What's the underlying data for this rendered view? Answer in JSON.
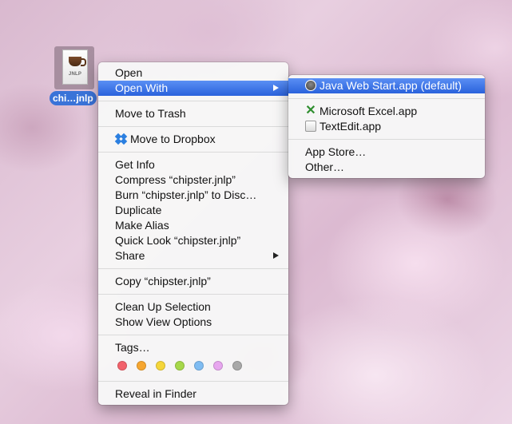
{
  "desktop_file": {
    "icon_label": "JNLP",
    "name": "chi…jnlp",
    "icon_name": "java-coffee-cup-icon"
  },
  "context_menu": {
    "items": [
      {
        "label": "Open"
      },
      {
        "label": "Open With"
      },
      {
        "label": "Move to Trash"
      },
      {
        "label": "Move to Dropbox",
        "icon": "dropbox-icon"
      },
      {
        "label": "Get Info"
      },
      {
        "label": "Compress “chipster.jnlp”"
      },
      {
        "label": "Burn “chipster.jnlp” to Disc…"
      },
      {
        "label": "Duplicate"
      },
      {
        "label": "Make Alias"
      },
      {
        "label": "Quick Look “chipster.jnlp”"
      },
      {
        "label": "Share"
      },
      {
        "label": "Copy “chipster.jnlp”"
      },
      {
        "label": "Clean Up Selection"
      },
      {
        "label": "Show View Options"
      },
      {
        "label": "Tags…"
      },
      {
        "label": "Reveal in Finder"
      }
    ],
    "tags": [
      {
        "name": "Red",
        "color": "#f2616b"
      },
      {
        "name": "Orange",
        "color": "#f6a630"
      },
      {
        "name": "Yellow",
        "color": "#f5d63a"
      },
      {
        "name": "Green",
        "color": "#a6d84a"
      },
      {
        "name": "Blue",
        "color": "#7fbcf2"
      },
      {
        "name": "Purple",
        "color": "#e7a6ef"
      },
      {
        "name": "Gray",
        "color": "#a8a8a8"
      }
    ]
  },
  "open_with_submenu": {
    "items": [
      {
        "label": "Java Web Start.app (default)",
        "icon": "java-icon"
      },
      {
        "label": "Microsoft Excel.app",
        "icon": "excel-icon"
      },
      {
        "label": "TextEdit.app",
        "icon": "textedit-icon"
      },
      {
        "label": "App Store…"
      },
      {
        "label": "Other…"
      }
    ]
  },
  "colors": {
    "highlight": "#2a62dc",
    "selection_label": "#3a73d8"
  }
}
